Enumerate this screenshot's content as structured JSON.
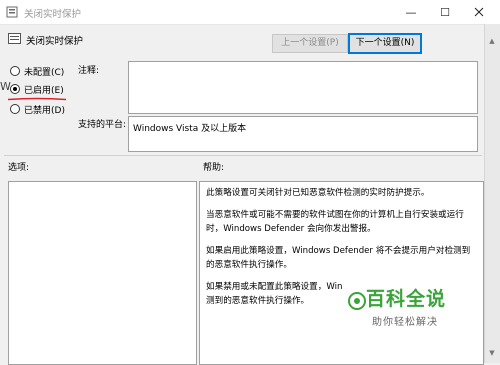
{
  "window": {
    "title": "关闭实时保护",
    "minimize": "—",
    "maximize": "☐"
  },
  "header": {
    "title": "关闭实时保护"
  },
  "nav": {
    "prev_label": "上一个设置(P)",
    "next_label": "下一个设置(N)"
  },
  "radios": [
    {
      "label": "未配置(C)",
      "checked": false
    },
    {
      "label": "已启用(E)",
      "checked": true
    },
    {
      "label": "已禁用(D)",
      "checked": false
    }
  ],
  "comment": {
    "label": "注释:",
    "value": ""
  },
  "platform": {
    "label": "支持的平台:",
    "value": "Windows Vista 及以上版本"
  },
  "options": {
    "label": "选项:"
  },
  "help": {
    "label": "帮助:",
    "paragraphs": [
      "此策略设置可关闭针对已知恶意软件检测的实时防护提示。",
      "    当恶意软件或可能不需要的软件试图在你的计算机上自行安装或运行时，Windows Defender 会向你发出警报。",
      "    如果启用此策略设置，Windows Defender 将不会提示用户对检测到的恶意软件执行操作。",
      "    如果禁用或未配置此策略设置，Win\n测到的恶意软件执行操作。"
    ]
  },
  "watermark": {
    "title": "百科全说",
    "subtitle": "助你轻松解决"
  },
  "background": {
    "letter": "W"
  },
  "icons": {
    "app": "policy-icon",
    "header": "policy-setting-icon"
  },
  "colors": {
    "accent": "#0078d7",
    "annotation": "#d9232e",
    "watermark": "#3aa33a"
  }
}
